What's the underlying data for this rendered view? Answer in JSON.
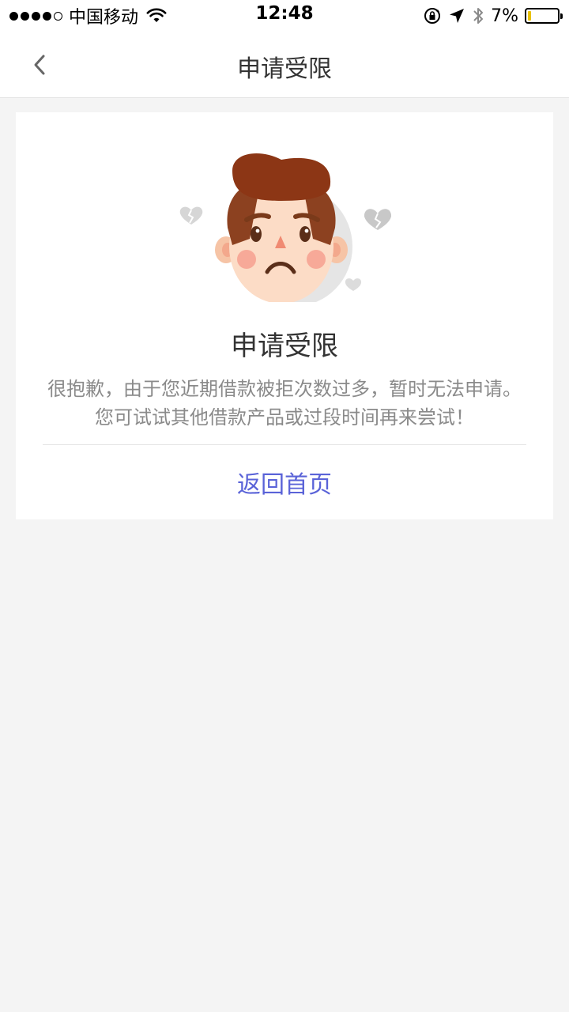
{
  "status_bar": {
    "carrier": "中国移动",
    "time": "12:48",
    "battery_percent": "7%",
    "battery_level": 0.07,
    "signal_bars": 4,
    "signal_max": 5,
    "icons": [
      "wifi-icon",
      "orientation-lock-icon",
      "location-icon",
      "bluetooth-icon",
      "battery-icon"
    ]
  },
  "nav": {
    "title": "申请受限",
    "back_icon": "chevron-left-icon"
  },
  "card": {
    "title": "申请受限",
    "message": "很抱歉，由于您近期借款被拒次数过多，暂时无法申请。您可试试其他借款产品或过段时间再来尝试！",
    "home_button": "返回首页",
    "illustration": "sad-face-with-broken-hearts-icon"
  },
  "colors": {
    "accent": "#5a63d8",
    "page_background": "#f4f4f4",
    "card_background": "#ffffff",
    "title_text": "#333333",
    "message_text": "#8a8a8a",
    "battery_fill": "#e8c100"
  }
}
